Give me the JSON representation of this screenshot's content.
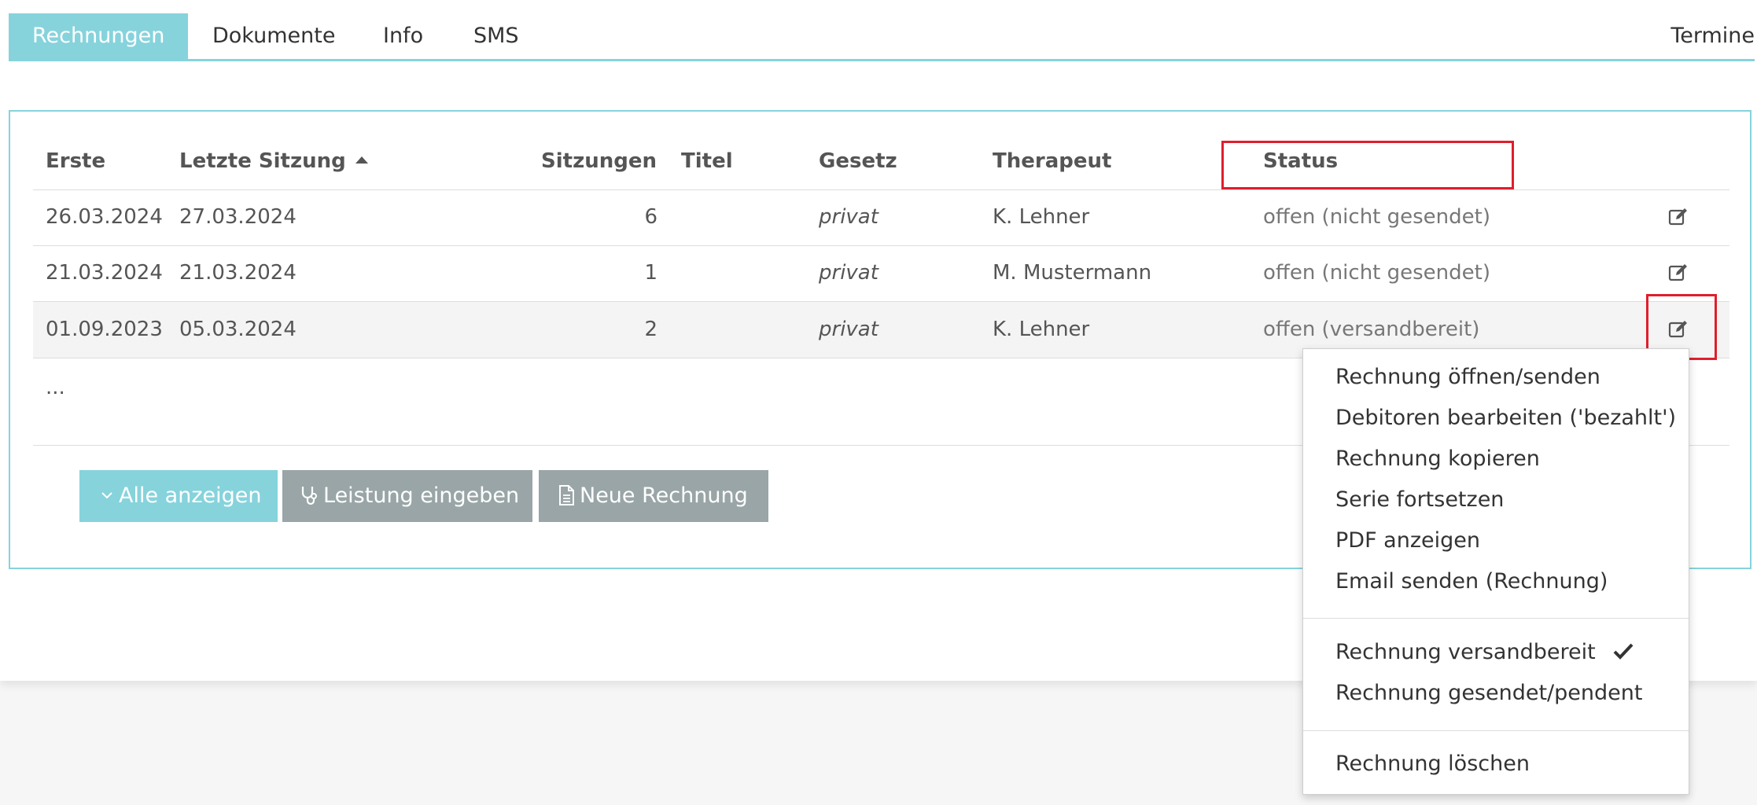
{
  "tabs": {
    "rechnungen": "Rechnungen",
    "dokumente": "Dokumente",
    "info": "Info",
    "sms": "SMS",
    "termine": "Termine"
  },
  "table": {
    "headers": {
      "erste": "Erste",
      "letzte": "Letzte Sitzung",
      "sitzungen": "Sitzungen",
      "titel": "Titel",
      "gesetz": "Gesetz",
      "therapeut": "Therapeut",
      "status": "Status"
    },
    "rows": [
      {
        "erste": "26.03.2024",
        "letzte": "27.03.2024",
        "sitzungen": "6",
        "titel": "",
        "gesetz": "privat",
        "therapeut": "K. Lehner",
        "status": "offen (nicht gesendet)"
      },
      {
        "erste": "21.03.2024",
        "letzte": "21.03.2024",
        "sitzungen": "1",
        "titel": "",
        "gesetz": "privat",
        "therapeut": "M. Mustermann",
        "status": "offen (nicht gesendet)"
      },
      {
        "erste": "01.09.2023",
        "letzte": "05.03.2024",
        "sitzungen": "2",
        "titel": "",
        "gesetz": "privat",
        "therapeut": "K. Lehner",
        "status": "offen (versandbereit)"
      }
    ],
    "more": "..."
  },
  "buttons": {
    "alle": "Alle anzeigen",
    "leistung": "Leistung eingeben",
    "neue": "Neue Rechnung"
  },
  "menu": {
    "items": [
      "Rechnung öffnen/senden",
      "Debitoren bearbeiten ('bezahlt')",
      "Rechnung kopieren",
      "Serie fortsetzen",
      "PDF anzeigen",
      "Email senden (Rechnung)",
      "Rechnung versandbereit",
      "Rechnung gesendet/pendent",
      "Rechnung löschen"
    ]
  },
  "colors": {
    "accent": "#86d3dc",
    "button_grey": "#99a5a6",
    "annotation": "#e01e2b"
  },
  "icons": {
    "edit": "edit-icon",
    "sort": "sort-ascending-icon",
    "chevron": "chevron-down-icon",
    "stethoscope": "stethoscope-icon",
    "document": "document-icon",
    "check": "checkmark-icon"
  }
}
